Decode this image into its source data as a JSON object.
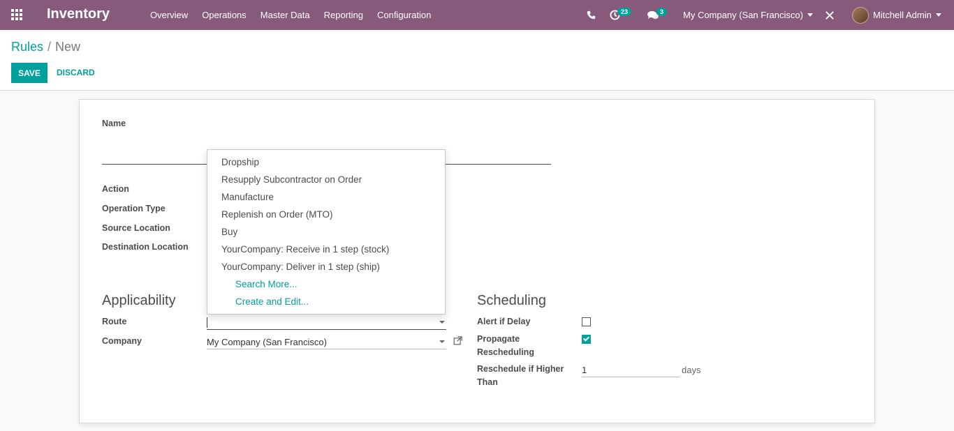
{
  "navbar": {
    "brand": "Inventory",
    "menu": [
      "Overview",
      "Operations",
      "Master Data",
      "Reporting",
      "Configuration"
    ],
    "activity_count": "23",
    "message_count": "3",
    "company": "My Company (San Francisco)",
    "user": "Mitchell Admin",
    "icons": {
      "apps": "apps-grid-icon",
      "phone": "phone-icon",
      "activity": "clock-icon",
      "chat": "chat-bubbles-icon",
      "debug": "tools-icon"
    }
  },
  "breadcrumb": {
    "parent": "Rules",
    "separator": "/",
    "current": "New"
  },
  "buttons": {
    "save": "SAVE",
    "discard": "DISCARD"
  },
  "form": {
    "name_label": "Name",
    "action_label": "Action",
    "operation_type_label": "Operation Type",
    "source_location_label": "Source Location",
    "destination_location_label": "Destination Location",
    "applicability_title": "Applicability",
    "route_label": "Route",
    "route_value": "",
    "company_label": "Company",
    "company_value": "My Company (San Francisco)",
    "scheduling_title": "Scheduling",
    "alert_if_delay_label": "Alert if Delay",
    "alert_if_delay_checked": false,
    "propagate_label_1": "Propagate",
    "propagate_label_2": "Rescheduling",
    "propagate_checked": true,
    "reschedule_label_1": "Reschedule if Higher",
    "reschedule_label_2": "Than",
    "reschedule_value": "1",
    "reschedule_unit": "days"
  },
  "dropdown": {
    "items": [
      "Dropship",
      "Resupply Subcontractor on Order",
      "Manufacture",
      "Replenish on Order (MTO)",
      "Buy",
      "YourCompany: Receive in 1 step (stock)",
      "YourCompany: Deliver in 1 step (ship)"
    ],
    "search_more": "Search More...",
    "create_and_edit": "Create and Edit..."
  }
}
